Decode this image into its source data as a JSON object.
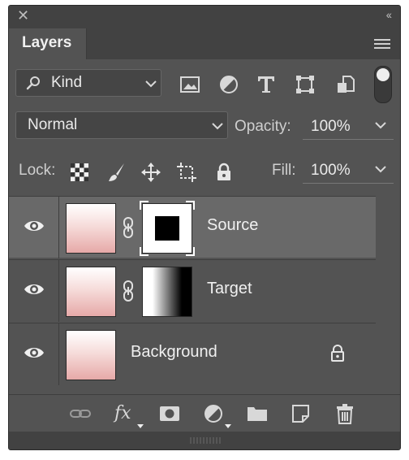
{
  "panel": {
    "tab_title": "Layers",
    "close_glyph": "✕",
    "collapse_glyph": "‹‹"
  },
  "filter": {
    "kind_label": "Kind",
    "icons": [
      "image-filter-icon",
      "adjustment-filter-icon",
      "type-filter-icon",
      "shape-filter-icon",
      "smart-object-filter-icon"
    ]
  },
  "blend": {
    "mode": "Normal",
    "opacity_label": "Opacity:",
    "opacity_value": "100%"
  },
  "lock": {
    "label": "Lock:",
    "fill_label": "Fill:",
    "fill_value": "100%"
  },
  "layers": [
    {
      "name": "Source",
      "selected": true,
      "mask": "square",
      "visible": true
    },
    {
      "name": "Target",
      "selected": false,
      "mask": "gradient",
      "visible": true
    },
    {
      "name": "Background",
      "selected": false,
      "mask": null,
      "visible": true,
      "locked": true
    }
  ],
  "bottom_toolbar": {
    "fx_label": "fx",
    "icons": [
      "link-layers-icon",
      "fx-icon",
      "add-mask-icon",
      "adjustment-layer-icon",
      "new-group-icon",
      "new-layer-icon",
      "delete-layer-icon"
    ]
  },
  "colors": {
    "panel_bg": "#535353",
    "selected_row": "#696969",
    "header_bg": "#424242"
  }
}
